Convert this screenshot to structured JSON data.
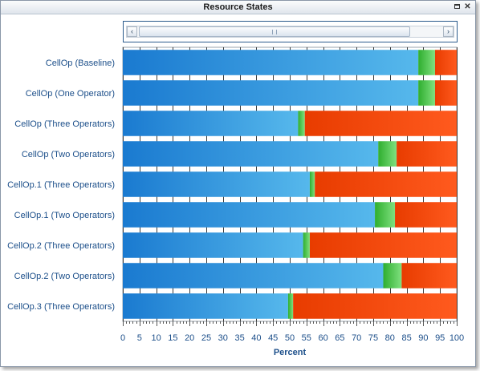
{
  "window": {
    "title": "Resource States",
    "restore_icon": "restore-icon",
    "close_icon": "close-icon"
  },
  "scrollbar": {
    "left_arrow": "‹",
    "right_arrow": "›",
    "thumb_start": 0,
    "thumb_size": 0.86
  },
  "colors": {
    "blue_dark": "#1a7ad0",
    "blue_light": "#56b8ec",
    "green_dark": "#2fae2f",
    "green_light": "#7fe07f",
    "red_dark": "#e83c00",
    "red_light": "#ff5a1e"
  },
  "chart_data": {
    "type": "bar",
    "orientation": "horizontal",
    "stacked": true,
    "categories": [
      "CellOp (Baseline)",
      "CellOp (One Operator)",
      "CellOp (Three Operators)",
      "CellOp (Two Operators)",
      "CellOp.1 (Three Operators)",
      "CellOp.1 (Two Operators)",
      "CellOp.2 (Three Operators)",
      "CellOp.2 (Two Operators)",
      "CellOp.3 (Three Operators)"
    ],
    "series": [
      {
        "color": "blue",
        "values": [
          88.5,
          88.5,
          52.5,
          76.5,
          56,
          75.5,
          54,
          78,
          49.5
        ]
      },
      {
        "color": "green",
        "values": [
          5,
          5,
          2,
          5.5,
          1.5,
          6,
          2,
          5.5,
          1.5
        ]
      },
      {
        "color": "red",
        "values": [
          6.5,
          6.5,
          45.5,
          18,
          42.5,
          18.5,
          44,
          16.5,
          49
        ]
      }
    ],
    "xlabel": "Percent",
    "ylabel": "",
    "xlim": [
      0,
      100
    ],
    "xticks": [
      0,
      5,
      10,
      15,
      20,
      25,
      30,
      35,
      40,
      45,
      50,
      55,
      60,
      65,
      70,
      75,
      80,
      85,
      90,
      95,
      100
    ],
    "grid": "vertical",
    "legend": "none"
  }
}
